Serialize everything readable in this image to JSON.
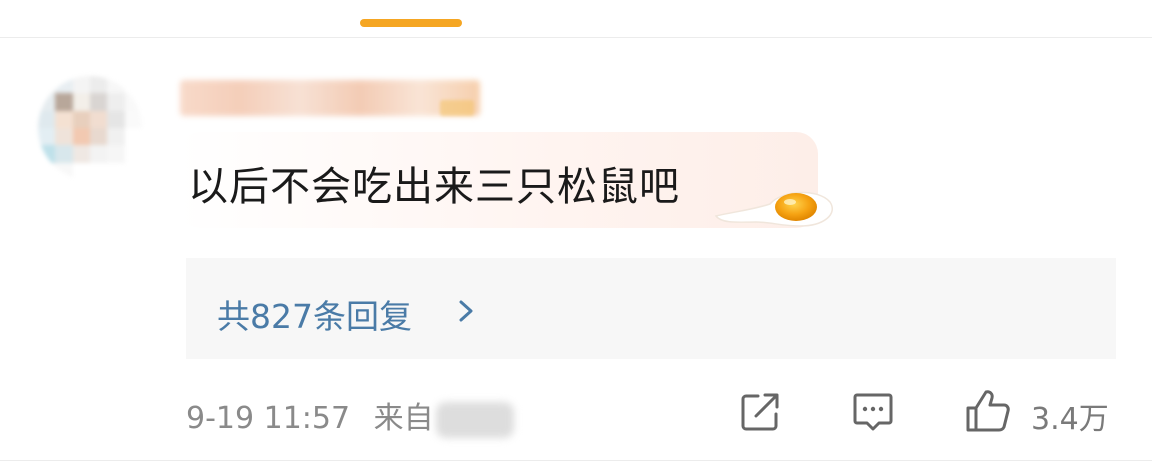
{
  "comment": {
    "text": "以后不会吃出来三只松鼠吧",
    "sticker_icon": "fried-egg-icon"
  },
  "replies": {
    "label": "共827条回复",
    "chevron_icon": "chevron-right-icon"
  },
  "meta": {
    "timestamp": "9-19 11:57",
    "source_prefix": "来自"
  },
  "actions": {
    "share_icon": "share-icon",
    "comment_icon": "comment-icon",
    "like_icon": "thumbs-up-icon",
    "like_count": "3.4万"
  },
  "colors": {
    "accent": "#f5a623",
    "link": "#4a7ba7",
    "reply_bg": "#f7f7f7",
    "meta_text": "#8a8a8a"
  }
}
